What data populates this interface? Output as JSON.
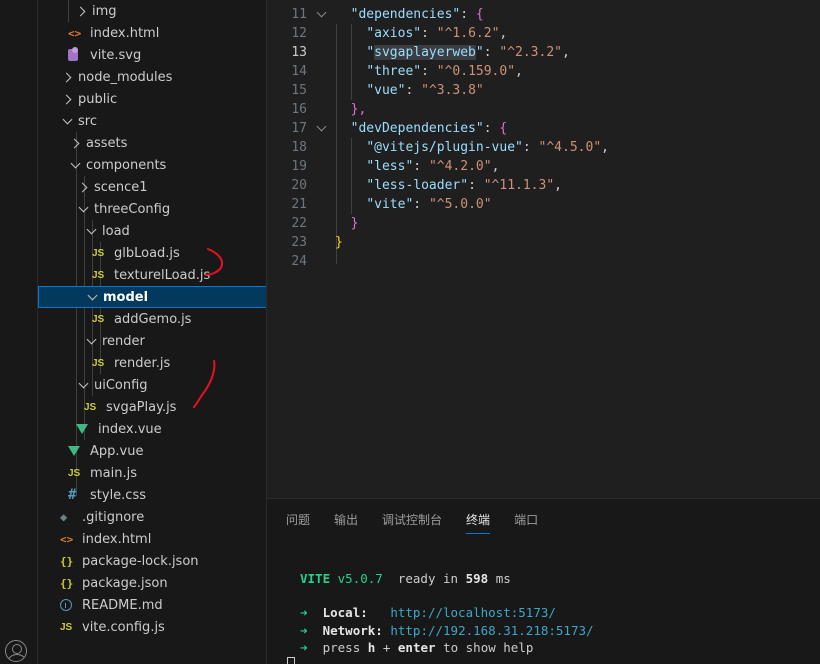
{
  "explorer": {
    "items": [
      {
        "label": "img",
        "icon": "chevron-right-icon",
        "kind": "folder"
      },
      {
        "label": "index.html",
        "icon": "html-icon",
        "kind": "file"
      },
      {
        "label": "vite.svg",
        "icon": "svg-icon",
        "kind": "file"
      },
      {
        "label": "node_modules",
        "icon": "chevron-right-icon",
        "kind": "folder"
      },
      {
        "label": "public",
        "icon": "chevron-right-icon",
        "kind": "folder"
      },
      {
        "label": "src",
        "icon": "chevron-down-icon",
        "kind": "folder"
      },
      {
        "label": "assets",
        "icon": "chevron-right-icon",
        "kind": "folder"
      },
      {
        "label": "components",
        "icon": "chevron-down-icon",
        "kind": "folder"
      },
      {
        "label": "scence1",
        "icon": "chevron-right-icon",
        "kind": "folder"
      },
      {
        "label": "threeConfig",
        "icon": "chevron-down-icon",
        "kind": "folder"
      },
      {
        "label": "load",
        "icon": "chevron-down-icon",
        "kind": "folder"
      },
      {
        "label": "glbLoad.js",
        "icon": "js-icon",
        "kind": "file"
      },
      {
        "label": "texturelLoad.js",
        "icon": "js-icon",
        "kind": "file"
      },
      {
        "label": "model",
        "icon": "chevron-down-icon",
        "kind": "folder",
        "selected": true
      },
      {
        "label": "addGemo.js",
        "icon": "js-icon",
        "kind": "file"
      },
      {
        "label": "render",
        "icon": "chevron-down-icon",
        "kind": "folder"
      },
      {
        "label": "render.js",
        "icon": "js-icon",
        "kind": "file"
      },
      {
        "label": "uiConfig",
        "icon": "chevron-down-icon",
        "kind": "folder"
      },
      {
        "label": "svgaPlay.js",
        "icon": "js-icon",
        "kind": "file"
      },
      {
        "label": "index.vue",
        "icon": "vue-icon",
        "kind": "file"
      },
      {
        "label": "App.vue",
        "icon": "vue-icon",
        "kind": "file"
      },
      {
        "label": "main.js",
        "icon": "js-icon",
        "kind": "file"
      },
      {
        "label": "style.css",
        "icon": "css-icon",
        "kind": "file"
      },
      {
        "label": ".gitignore",
        "icon": "git-icon",
        "kind": "file"
      },
      {
        "label": "index.html",
        "icon": "html-icon",
        "kind": "file"
      },
      {
        "label": "package-lock.json",
        "icon": "json-icon",
        "kind": "file"
      },
      {
        "label": "package.json",
        "icon": "json-icon",
        "kind": "file"
      },
      {
        "label": "README.md",
        "icon": "info-icon",
        "kind": "file"
      },
      {
        "label": "vite.config.js",
        "icon": "js-icon",
        "kind": "file"
      }
    ]
  },
  "editor": {
    "active_line": "13",
    "lines": [
      {
        "num": "11",
        "key": "dependencies",
        "value": "{",
        "fold": true
      },
      {
        "num": "12",
        "key": "axios",
        "value": "^1.6.2"
      },
      {
        "num": "13",
        "key": "svgaplayerweb",
        "value": "^2.3.2"
      },
      {
        "num": "14",
        "key": "three",
        "value": "^0.159.0"
      },
      {
        "num": "15",
        "key": "vue",
        "value": "^3.3.8"
      },
      {
        "num": "16",
        "close": "},"
      },
      {
        "num": "17",
        "key": "devDependencies",
        "value": "{",
        "fold": true
      },
      {
        "num": "18",
        "key": "@vitejs/plugin-vue",
        "value": "^4.5.0"
      },
      {
        "num": "19",
        "key": "less",
        "value": "^4.2.0"
      },
      {
        "num": "20",
        "key": "less-loader",
        "value": "^11.1.3"
      },
      {
        "num": "21",
        "key": "vite",
        "value": "^5.0.0"
      },
      {
        "num": "22",
        "close": "}"
      },
      {
        "num": "23",
        "close_outer": "}"
      },
      {
        "num": "24"
      }
    ]
  },
  "panel": {
    "tabs": [
      "问题",
      "输出",
      "调试控制台",
      "终端",
      "端口"
    ],
    "active_tab": "终端",
    "terminal": {
      "vite_label": "VITE",
      "vite_version": "v5.0.7",
      "ready_text": "ready in",
      "ready_ms": "598",
      "ms_unit": "ms",
      "arrow": "➜",
      "local_label": "Local:",
      "local_url": "http://localhost:5173/",
      "network_label": "Network:",
      "network_url": "http://192.168.31.218:5173/",
      "press_text": "press",
      "h_key": "h",
      "plus": "+",
      "enter_key": "enter",
      "help_text": "to show help"
    }
  },
  "colors": {
    "accent": "#0078d4",
    "annotation": "#e81123"
  }
}
